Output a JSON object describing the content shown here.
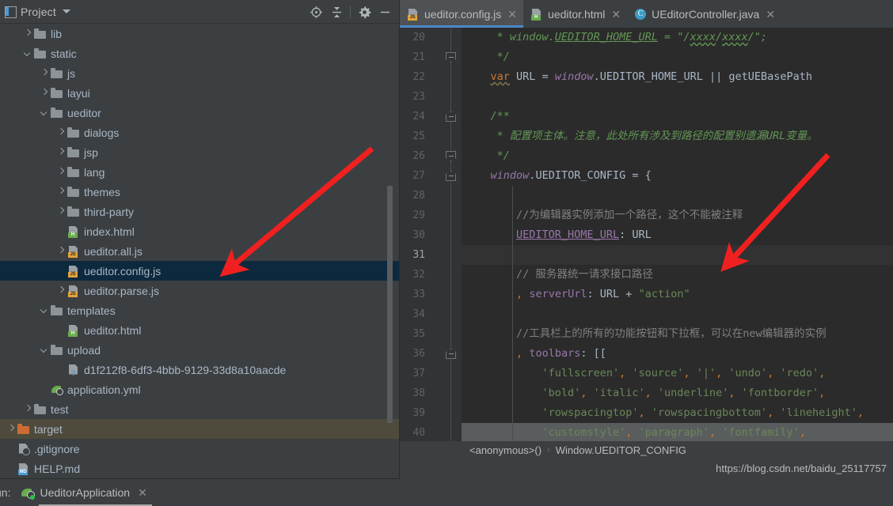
{
  "project_panel": {
    "title": "Project",
    "icon": "project-panel-icon",
    "tools": [
      {
        "name": "locate-in-tree-icon",
        "label": "Select Opened File"
      },
      {
        "name": "collapse-all-icon",
        "label": "Collapse All"
      },
      {
        "name": "gear-icon",
        "label": "Settings"
      },
      {
        "name": "minimize-icon",
        "label": "Hide"
      }
    ],
    "tree": [
      {
        "label": "lib",
        "type": "folder",
        "indent": 1,
        "arrow": "right",
        "state": "normal"
      },
      {
        "label": "static",
        "type": "folder",
        "indent": 1,
        "arrow": "down",
        "state": "normal"
      },
      {
        "label": "js",
        "type": "folder",
        "indent": 2,
        "arrow": "right",
        "state": "normal"
      },
      {
        "label": "layui",
        "type": "folder",
        "indent": 2,
        "arrow": "right",
        "state": "normal"
      },
      {
        "label": "ueditor",
        "type": "folder",
        "indent": 2,
        "arrow": "down",
        "state": "normal"
      },
      {
        "label": "dialogs",
        "type": "folder",
        "indent": 3,
        "arrow": "right",
        "state": "normal"
      },
      {
        "label": "jsp",
        "type": "folder",
        "indent": 3,
        "arrow": "right",
        "state": "normal"
      },
      {
        "label": "lang",
        "type": "folder",
        "indent": 3,
        "arrow": "right",
        "state": "normal"
      },
      {
        "label": "themes",
        "type": "folder",
        "indent": 3,
        "arrow": "right",
        "state": "normal"
      },
      {
        "label": "third-party",
        "type": "folder",
        "indent": 3,
        "arrow": "right",
        "state": "normal"
      },
      {
        "label": "index.html",
        "type": "html",
        "indent": 3,
        "arrow": "none",
        "state": "normal"
      },
      {
        "label": "ueditor.all.js",
        "type": "js",
        "indent": 3,
        "arrow": "right",
        "state": "normal"
      },
      {
        "label": "ueditor.config.js",
        "type": "js",
        "indent": 3,
        "arrow": "none",
        "state": "selected"
      },
      {
        "label": "ueditor.parse.js",
        "type": "js",
        "indent": 3,
        "arrow": "right",
        "state": "normal"
      },
      {
        "label": "templates",
        "type": "folder",
        "indent": 2,
        "arrow": "down",
        "state": "normal"
      },
      {
        "label": "ueditor.html",
        "type": "html",
        "indent": 3,
        "arrow": "none",
        "state": "normal"
      },
      {
        "label": "upload",
        "type": "folder",
        "indent": 2,
        "arrow": "down",
        "state": "normal"
      },
      {
        "label": "d1f212f8-6df3-4bbb-9129-33d8a10aacde",
        "type": "unknown",
        "indent": 3,
        "arrow": "none",
        "state": "normal"
      },
      {
        "label": "application.yml",
        "type": "yml",
        "indent": 2,
        "arrow": "none",
        "state": "normal"
      },
      {
        "label": "test",
        "type": "folder",
        "indent": 1,
        "arrow": "right",
        "state": "normal"
      },
      {
        "label": "target",
        "type": "folder-orange",
        "indent": 0,
        "arrow": "right",
        "state": "hover"
      },
      {
        "label": ".gitignore",
        "type": "git",
        "indent": 0,
        "arrow": "none",
        "state": "normal"
      },
      {
        "label": "HELP.md",
        "type": "md",
        "indent": 0,
        "arrow": "none",
        "state": "normal"
      }
    ]
  },
  "editor": {
    "tabs": [
      {
        "label": "ueditor.config.js",
        "icon": "js-file-icon",
        "active": true
      },
      {
        "label": "ueditor.html",
        "icon": "html-file-icon",
        "active": false
      },
      {
        "label": "UEditorController.java",
        "icon": "java-class-icon",
        "active": false
      }
    ],
    "close_glyph": "✕",
    "first_line_number": 20,
    "current_line": 31,
    "lines": [
      {
        "n": 20,
        "fold": "none",
        "state": "normal"
      },
      {
        "n": 21,
        "fold": "open",
        "state": "normal"
      },
      {
        "n": 22,
        "fold": "none",
        "state": "normal"
      },
      {
        "n": 23,
        "fold": "none",
        "state": "normal"
      },
      {
        "n": 24,
        "fold": "close",
        "state": "normal"
      },
      {
        "n": 25,
        "fold": "none",
        "state": "normal"
      },
      {
        "n": 26,
        "fold": "open",
        "state": "normal"
      },
      {
        "n": 27,
        "fold": "close",
        "state": "normal"
      },
      {
        "n": 28,
        "fold": "none",
        "state": "normal"
      },
      {
        "n": 29,
        "fold": "none",
        "state": "normal"
      },
      {
        "n": 30,
        "fold": "none",
        "state": "normal"
      },
      {
        "n": 31,
        "fold": "none",
        "state": "active"
      },
      {
        "n": 32,
        "fold": "none",
        "state": "normal"
      },
      {
        "n": 33,
        "fold": "none",
        "state": "normal"
      },
      {
        "n": 34,
        "fold": "none",
        "state": "normal"
      },
      {
        "n": 35,
        "fold": "none",
        "state": "normal"
      },
      {
        "n": 36,
        "fold": "close",
        "state": "normal"
      },
      {
        "n": 37,
        "fold": "none",
        "state": "normal"
      },
      {
        "n": 38,
        "fold": "none",
        "state": "normal"
      },
      {
        "n": 39,
        "fold": "none",
        "state": "normal"
      },
      {
        "n": 40,
        "fold": "none",
        "state": "highlight"
      }
    ],
    "code_text": {
      "l20": "     * window.UEDITOR_HOME_URL = \"/xxxx/xxxx/\";",
      "l21": "     */",
      "l22": "    var URL = window.UEDITOR_HOME_URL || getUEBasePath",
      "l23": "",
      "l24": "    /**",
      "l25": "     * 配置项主体。注意，此处所有涉及到路径的配置别遗漏URL变量。",
      "l26": "     */",
      "l27": "    window.UEDITOR_CONFIG = {",
      "l28": "",
      "l29": "        //为编辑器实例添加一个路径，这个不能被注释",
      "l30": "        UEDITOR_HOME_URL: URL",
      "l31": "",
      "l32": "        // 服务器统一请求接口路径",
      "l33": "        , serverUrl: URL + \"action\"",
      "l34": "",
      "l35": "        //工具栏上的所有的功能按钮和下拉框，可以在new编辑器的实例",
      "l36": "        , toolbars: [[",
      "l37": "            'fullscreen', 'source', '|', 'undo', 'redo',",
      "l38": "            'bold', 'italic', 'underline', 'fontborder',",
      "l39": "            'rowspacingtop', 'rowspacingbottom', 'lineheight',",
      "l40": "            'customstyle', 'paragraph', 'fontfamily',"
    },
    "breadcrumb": [
      {
        "label": "<anonymous>()"
      },
      {
        "label": "Window.UEDITOR_CONFIG"
      }
    ],
    "breadcrumb_separator": "›",
    "watermark": "https://blog.csdn.net/baidu_25117757"
  },
  "annotations": {
    "box_color": "#f02020",
    "arrow_color": "#f02020",
    "arrows": 2,
    "box_target": "serverUrl config lines 32-33"
  },
  "run_bar": {
    "label": "un:",
    "full_label": "Run:",
    "tab_name": "UeditorApplication",
    "close_glyph": "✕",
    "status": "running"
  }
}
